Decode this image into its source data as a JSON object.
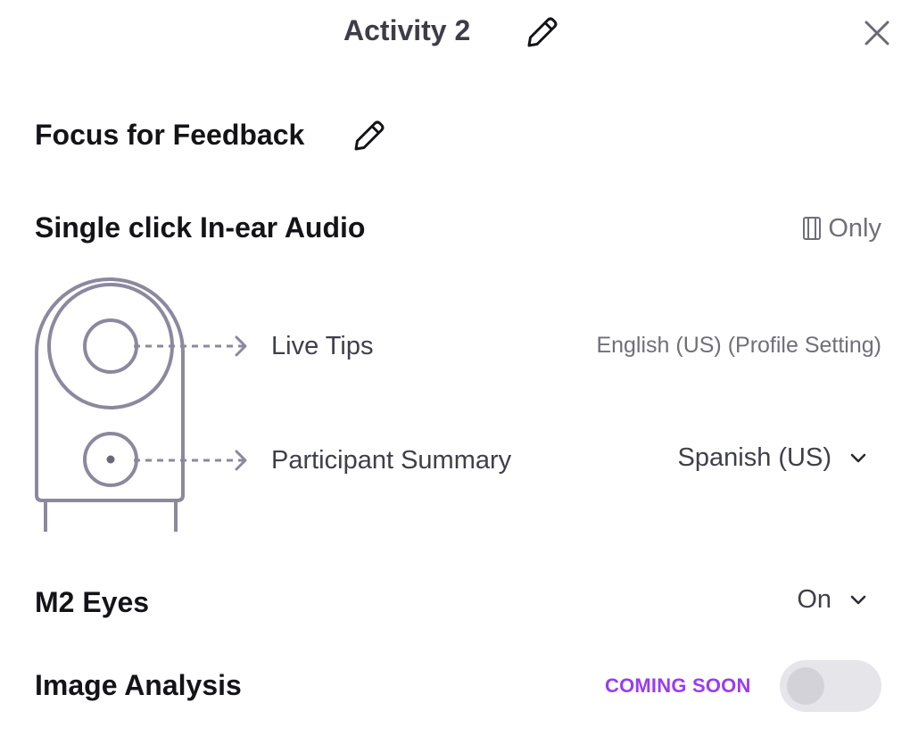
{
  "header": {
    "title": "Activity 2"
  },
  "sections": {
    "focus": {
      "label": "Focus for Feedback"
    },
    "audio": {
      "label": "Single click In-ear Audio",
      "device_label": "Only",
      "rows": [
        {
          "label": "Live Tips",
          "value": "English (US) (Profile Setting)"
        },
        {
          "label": "Participant Summary",
          "value": "Spanish (US)"
        }
      ]
    },
    "m2_eyes": {
      "label": "M2 Eyes",
      "value": "On"
    },
    "image_analysis": {
      "label": "Image Analysis",
      "badge": "COMING SOON",
      "toggle_on": false
    }
  },
  "icons": {
    "edit": "pencil-icon",
    "close": "close-icon",
    "device": "device-icon",
    "dropdown": "chevron-down-icon"
  },
  "colors": {
    "badge": "#9a3df0",
    "device_stroke": "#8c889e",
    "muted_text": "#6f6f7a",
    "toggle_track": "#e6e5ea"
  }
}
